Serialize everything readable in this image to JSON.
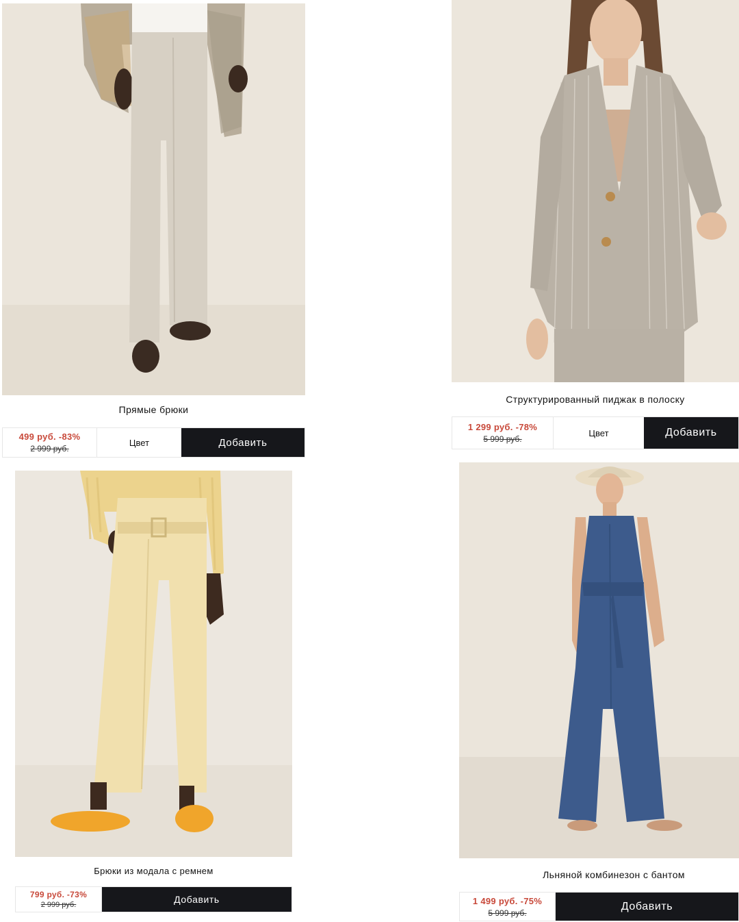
{
  "products": [
    {
      "name": "Прямые брюки",
      "sale_price": "499 руб. -83%",
      "original_price": "2 999 руб.",
      "color_label": "Цвет",
      "add_label": "Добавить"
    },
    {
      "name": "Структурированный пиджак в полоску",
      "sale_price": "1 299 руб. -78%",
      "original_price": "5 999 руб.",
      "color_label": "Цвет",
      "add_label": "Добавить"
    },
    {
      "name": "Брюки из модала с ремнем",
      "sale_price": "799 руб. -73%",
      "original_price": "2 999 руб.",
      "add_label": "Добавить"
    },
    {
      "name": "Льняной комбинезон с бантом",
      "sale_price": "1 499 руб. -75%",
      "original_price": "5 999 руб.",
      "add_label": "Добавить"
    }
  ],
  "colors": {
    "sale": "#c8493a",
    "button_bg": "#16171b",
    "button_text": "#ffffff"
  }
}
